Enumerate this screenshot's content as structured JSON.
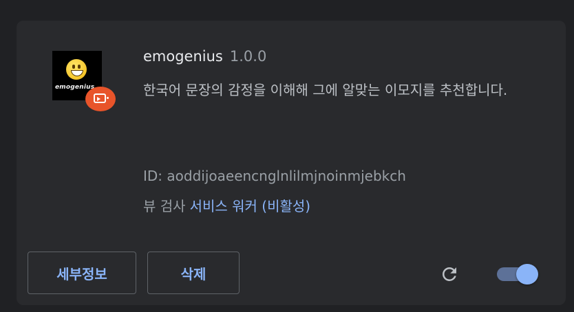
{
  "extension": {
    "name": "emogenius",
    "version": "1.0.0",
    "description": "한국어 문장의 감정을 이해해 그에 알맞는 이모지를 추천합니다.",
    "id_text": "ID: aoddijoaeencnglnlilmjnoinmjebkch",
    "icon_text": "emogenius",
    "icon": "smiley-face-icon",
    "badge_icon": "policy-installed-badge-icon"
  },
  "inspect": {
    "label": "뷰 검사",
    "link": "서비스 워커 (비활성)"
  },
  "actions": {
    "details_label": "세부정보",
    "remove_label": "삭제",
    "reload_icon": "reload-icon",
    "toggle_enabled": true
  },
  "colors": {
    "background": "#202124",
    "card": "#292a2d",
    "accent": "#8ab4f8",
    "badge": "#e8542a"
  }
}
